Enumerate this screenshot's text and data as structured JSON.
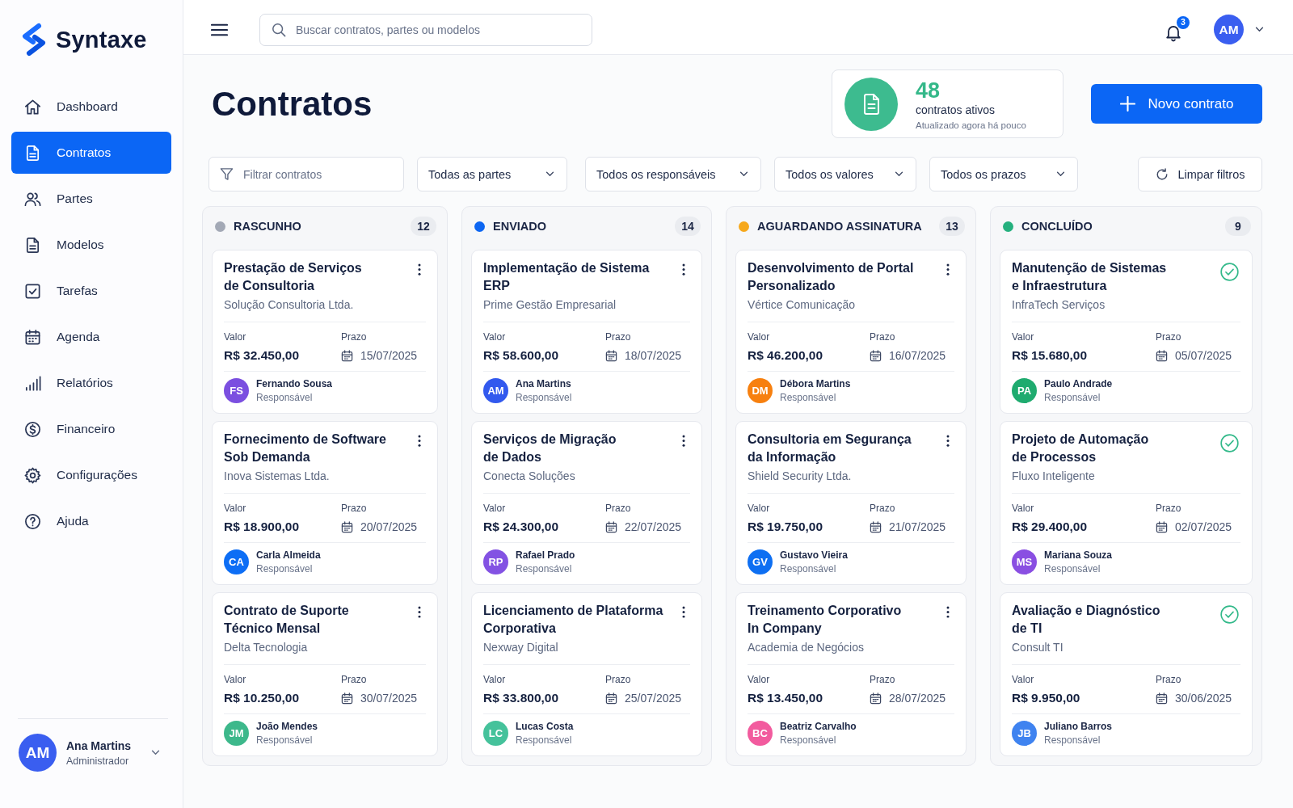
{
  "sidebar": {
    "logo": "Syntaxe",
    "items": [
      {
        "label": "Dashboard",
        "selected": false
      },
      {
        "label": "Contratos",
        "selected": true
      },
      {
        "label": "Partes",
        "selected": false
      },
      {
        "label": "Modelos",
        "selected": false
      },
      {
        "label": "Tarefas",
        "selected": false
      },
      {
        "label": "Agenda",
        "selected": false
      },
      {
        "label": "Relatórios",
        "selected": false
      },
      {
        "label": "Financeiro",
        "selected": false
      },
      {
        "label": "Configurações",
        "selected": false
      },
      {
        "label": "Ajuda",
        "selected": false
      }
    ],
    "user": {
      "initials": "AM",
      "name": "Ana Martins",
      "role": "Administrador"
    }
  },
  "topbar": {
    "search": {
      "placeholder": "Buscar contratos, partes ou modelos"
    },
    "notifications": "3",
    "avatar": "AM"
  },
  "header": {
    "title": "Contratos",
    "stat": {
      "value": "48",
      "label": "contratos ativos",
      "note": "Atualizado agora há pouco"
    },
    "new_button": "Novo contrato"
  },
  "filters": {
    "search": {
      "placeholder": "Filtrar contratos"
    },
    "dropdowns": [
      "Todas as partes",
      "Todos os responsáveis",
      "Todos os valores",
      "Todos os prazos"
    ],
    "clear": "Limpar filtros"
  },
  "board": {
    "columns": [
      {
        "title": "RASCUNHO",
        "count": "12",
        "color": "#a3a9b6",
        "cards": [
          {
            "title_lines": [
              "Prestação de Serviços",
              "de Consultoria"
            ],
            "company": "Solução Consultoria Ltda.",
            "value_label": "Valor",
            "value": "R$ 32.450,00",
            "due_label": "Prazo",
            "due": "15/07/2025",
            "owner": {
              "initials": "FS",
              "name": "Fernando Sousa",
              "role": "Responsável",
              "color": "#7b4fe0"
            },
            "completed": false
          },
          {
            "title_lines": [
              "Fornecimento de Software",
              "Sob Demanda"
            ],
            "company": "Inova Sistemas Ltda.",
            "value_label": "Valor",
            "value": "R$ 18.900,00",
            "due_label": "Prazo",
            "due": "20/07/2025",
            "owner": {
              "initials": "CA",
              "name": "Carla Almeida",
              "role": "Responsável",
              "color": "#0d6ef5"
            },
            "completed": false
          },
          {
            "title_lines": [
              "Contrato de Suporte",
              "Técnico Mensal"
            ],
            "company": "Delta Tecnologia",
            "value_label": "Valor",
            "value": "R$ 10.250,00",
            "due_label": "Prazo",
            "due": "30/07/2025",
            "owner": {
              "initials": "JM",
              "name": "João Mendes",
              "role": "Responsável",
              "color": "#3db88b"
            },
            "completed": false
          }
        ]
      },
      {
        "title": "ENVIADO",
        "count": "14",
        "color": "#0d66f2",
        "cards": [
          {
            "title_lines": [
              "Implementação de Sistema",
              "ERP"
            ],
            "company": "Prime Gestão Empresarial",
            "value_label": "Valor",
            "value": "R$ 58.600,00",
            "due_label": "Prazo",
            "due": "18/07/2025",
            "owner": {
              "initials": "AM",
              "name": "Ana Martins",
              "role": "Responsável",
              "color": "#3259ee"
            },
            "completed": false
          },
          {
            "title_lines": [
              "Serviços de Migração",
              "de Dados"
            ],
            "company": "Conecta Soluções",
            "value_label": "Valor",
            "value": "R$ 24.300,00",
            "due_label": "Prazo",
            "due": "22/07/2025",
            "owner": {
              "initials": "RP",
              "name": "Rafael Prado",
              "role": "Responsável",
              "color": "#8352e3"
            },
            "completed": false
          },
          {
            "title_lines": [
              "Licenciamento de Plataforma",
              "Corporativa"
            ],
            "company": "Nexway Digital",
            "value_label": "Valor",
            "value": "R$ 33.800,00",
            "due_label": "Prazo",
            "due": "25/07/2025",
            "owner": {
              "initials": "LC",
              "name": "Lucas Costa",
              "role": "Responsável",
              "color": "#45c29b"
            },
            "completed": false
          }
        ]
      },
      {
        "title": "AGUARDANDO ASSINATURA",
        "count": "13",
        "color": "#f6a81c",
        "cards": [
          {
            "title_lines": [
              "Desenvolvimento de Portal",
              "Personalizado"
            ],
            "company": "Vértice Comunicação",
            "value_label": "Valor",
            "value": "R$ 46.200,00",
            "due_label": "Prazo",
            "due": "16/07/2025",
            "owner": {
              "initials": "DM",
              "name": "Débora Martins",
              "role": "Responsável",
              "color": "#f7800f"
            },
            "completed": false
          },
          {
            "title_lines": [
              "Consultoria em Segurança",
              "da Informação"
            ],
            "company": "Shield Security Ltda.",
            "value_label": "Valor",
            "value": "R$ 19.750,00",
            "due_label": "Prazo",
            "due": "21/07/2025",
            "owner": {
              "initials": "GV",
              "name": "Gustavo Vieira",
              "role": "Responsável",
              "color": "#0e6ff2"
            },
            "completed": false
          },
          {
            "title_lines": [
              "Treinamento Corporativo",
              "In Company"
            ],
            "company": "Academia de Negócios",
            "value_label": "Valor",
            "value": "R$ 13.450,00",
            "due_label": "Prazo",
            "due": "28/07/2025",
            "owner": {
              "initials": "BC",
              "name": "Beatriz Carvalho",
              "role": "Responsável",
              "color": "#f25b9e"
            },
            "completed": false
          }
        ]
      },
      {
        "title": "CONCLUÍDO",
        "count": "9",
        "color": "#25b07e",
        "cards": [
          {
            "title_lines": [
              "Manutenção de Sistemas",
              "e Infraestrutura"
            ],
            "company": "InfraTech Serviços",
            "value_label": "Valor",
            "value": "R$ 15.680,00",
            "due_label": "Prazo",
            "due": "05/07/2025",
            "owner": {
              "initials": "PA",
              "name": "Paulo Andrade",
              "role": "Responsável",
              "color": "#1fab6f"
            },
            "completed": true
          },
          {
            "title_lines": [
              "Projeto de Automação",
              "de Processos"
            ],
            "company": "Fluxo Inteligente",
            "value_label": "Valor",
            "value": "R$ 29.400,00",
            "due_label": "Prazo",
            "due": "02/07/2025",
            "owner": {
              "initials": "MS",
              "name": "Mariana Souza",
              "role": "Responsável",
              "color": "#8a4fe2"
            },
            "completed": true
          },
          {
            "title_lines": [
              "Avaliação e Diagnóstico",
              "de TI"
            ],
            "company": "Consult TI",
            "value_label": "Valor",
            "value": "R$ 9.950,00",
            "due_label": "Prazo",
            "due": "30/06/2025",
            "owner": {
              "initials": "JB",
              "name": "Juliano Barros",
              "role": "Responsável",
              "color": "#3f83f0"
            },
            "completed": true
          }
        ]
      }
    ]
  }
}
